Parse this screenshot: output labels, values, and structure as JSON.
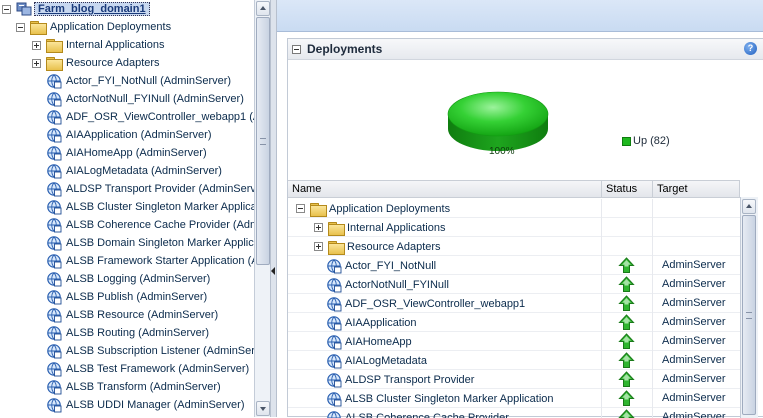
{
  "navigator": {
    "root": {
      "label": "Farm_blog_domain1"
    },
    "folder": {
      "label": "Application Deployments"
    },
    "subfolders": [
      {
        "label": "Internal Applications"
      },
      {
        "label": "Resource Adapters"
      }
    ],
    "apps": [
      "Actor_FYI_NotNull (AdminServer)",
      "ActorNotNull_FYINull (AdminServer)",
      "ADF_OSR_ViewController_webapp1 (A",
      "AIAApplication (AdminServer)",
      "AIAHomeApp (AdminServer)",
      "AIALogMetadata (AdminServer)",
      "ALDSP Transport Provider (AdminServe",
      "ALSB Cluster Singleton Marker Applicati",
      "ALSB Coherence Cache Provider (Admi",
      "ALSB Domain Singleton Marker Applicat",
      "ALSB Framework Starter Application (A",
      "ALSB Logging (AdminServer)",
      "ALSB Publish (AdminServer)",
      "ALSB Resource (AdminServer)",
      "ALSB Routing (AdminServer)",
      "ALSB Subscription Listener (AdminServe",
      "ALSB Test Framework (AdminServer)",
      "ALSB Transform (AdminServer)",
      "ALSB UDDI Manager (AdminServer)"
    ]
  },
  "panel": {
    "title": "Deployments",
    "help": "?"
  },
  "chart_data": {
    "type": "pie",
    "slices": [
      {
        "label": "Up",
        "count": 82,
        "percent": 100,
        "color": "#1fb81f"
      }
    ],
    "slice_label": "100%",
    "legend": {
      "text": "Up (82)",
      "placement": "right"
    }
  },
  "table": {
    "columns": {
      "name": "Name",
      "status": "Status",
      "target": "Target"
    },
    "folder_row": {
      "name": "Application Deployments"
    },
    "subfolder_rows": [
      {
        "name": "Internal Applications"
      },
      {
        "name": "Resource Adapters"
      }
    ],
    "app_rows": [
      {
        "name": "Actor_FYI_NotNull",
        "status": "up",
        "target": "AdminServer"
      },
      {
        "name": "ActorNotNull_FYINull",
        "status": "up",
        "target": "AdminServer"
      },
      {
        "name": "ADF_OSR_ViewController_webapp1",
        "status": "up",
        "target": "AdminServer"
      },
      {
        "name": "AIAApplication",
        "status": "up",
        "target": "AdminServer"
      },
      {
        "name": "AIAHomeApp",
        "status": "up",
        "target": "AdminServer"
      },
      {
        "name": "AIALogMetadata",
        "status": "up",
        "target": "AdminServer"
      },
      {
        "name": "ALDSP Transport Provider",
        "status": "up",
        "target": "AdminServer"
      },
      {
        "name": "ALSB Cluster Singleton Marker Application",
        "status": "up",
        "target": "AdminServer"
      },
      {
        "name": "ALSB Coherence Cache Provider",
        "status": "up",
        "target": "AdminServer"
      }
    ]
  },
  "colors": {
    "status_up": "#2fb52f",
    "selection": "#c8d8f0",
    "header_band": "#c9dbf2"
  },
  "icons": {
    "root": "domain-icon",
    "folder": "folder-icon",
    "app": "web-app-icon",
    "status": "up-arrow-icon"
  }
}
